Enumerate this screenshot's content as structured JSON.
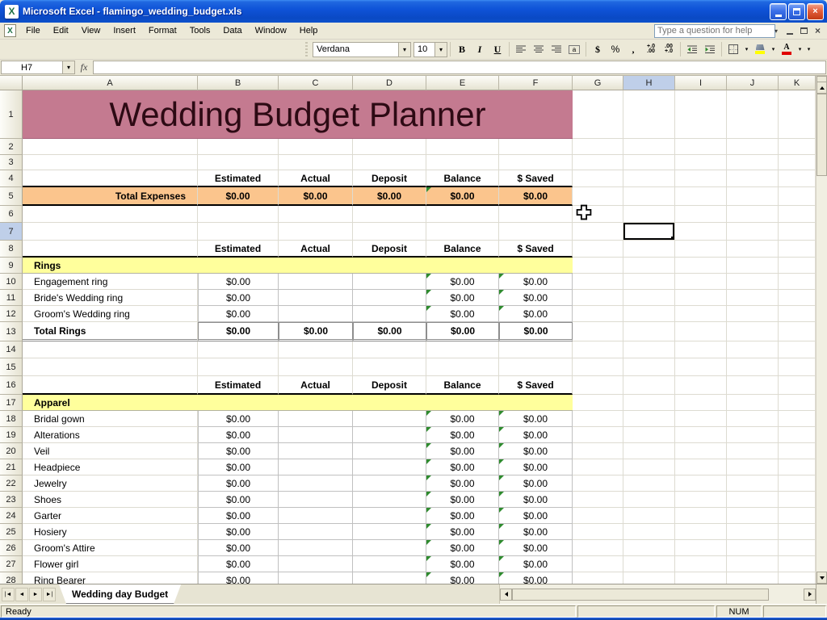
{
  "window": {
    "title": "Microsoft Excel - flamingo_wedding_budget.xls"
  },
  "menu": {
    "items": [
      "File",
      "Edit",
      "View",
      "Insert",
      "Format",
      "Tools",
      "Data",
      "Window",
      "Help"
    ],
    "help_placeholder": "Type a question for help"
  },
  "toolbar": {
    "font_name": "Verdana",
    "font_size": "10",
    "buttons": {
      "bold": "B",
      "italic": "I",
      "underline": "U",
      "currency": "$",
      "percent": "%",
      "comma": ",",
      "inc_top": "+.0",
      "inc_bottom": ".00",
      "dec_top": ".00",
      "dec_bottom": "+.0",
      "font_color_letter": "A"
    }
  },
  "formula_bar": {
    "name_box": "H7",
    "fx_label": "fx",
    "formula_value": ""
  },
  "grid": {
    "columns": [
      "A",
      "B",
      "C",
      "D",
      "E",
      "F",
      "G",
      "H",
      "I",
      "J",
      "K"
    ],
    "active_column": "H",
    "active_row": 7,
    "title": "Wedding Budget Planner",
    "value_headers": [
      "Estimated",
      "Actual",
      "Deposit",
      "Balance",
      "$ Saved"
    ],
    "zero": "$0.00",
    "total_expenses_label": "Total Expenses",
    "rows": [
      {
        "n": 1,
        "type": "banner"
      },
      {
        "n": 2,
        "type": "empty"
      },
      {
        "n": 3,
        "type": "empty"
      },
      {
        "n": 4,
        "type": "headers"
      },
      {
        "n": 5,
        "type": "total_expenses"
      },
      {
        "n": 6,
        "type": "empty"
      },
      {
        "n": 7,
        "type": "empty"
      },
      {
        "n": 8,
        "type": "headers"
      },
      {
        "n": 9,
        "type": "section",
        "label": "Rings"
      },
      {
        "n": 10,
        "type": "item",
        "label": "Engagement ring"
      },
      {
        "n": 11,
        "type": "item",
        "label": "Bride's Wedding ring"
      },
      {
        "n": 12,
        "type": "item",
        "label": "Groom's Wedding ring"
      },
      {
        "n": 13,
        "type": "total",
        "label": "Total Rings"
      },
      {
        "n": 14,
        "type": "empty"
      },
      {
        "n": 15,
        "type": "empty"
      },
      {
        "n": 16,
        "type": "headers"
      },
      {
        "n": 17,
        "type": "section",
        "label": "Apparel"
      },
      {
        "n": 18,
        "type": "item",
        "label": "Bridal gown"
      },
      {
        "n": 19,
        "type": "item",
        "label": "Alterations"
      },
      {
        "n": 20,
        "type": "item",
        "label": "Veil"
      },
      {
        "n": 21,
        "type": "item",
        "label": "Headpiece"
      },
      {
        "n": 22,
        "type": "item",
        "label": "Jewelry"
      },
      {
        "n": 23,
        "type": "item",
        "label": "Shoes"
      },
      {
        "n": 24,
        "type": "item",
        "label": "Garter"
      },
      {
        "n": 25,
        "type": "item",
        "label": "Hosiery"
      },
      {
        "n": 26,
        "type": "item",
        "label": "Groom's Attire"
      },
      {
        "n": 27,
        "type": "item",
        "label": "Flower girl"
      },
      {
        "n": 28,
        "type": "item",
        "label": "Ring Bearer"
      }
    ]
  },
  "sheet_tabs": {
    "active": "Wedding day Budget"
  },
  "status_bar": {
    "ready": "Ready",
    "num": "NUM"
  },
  "icons": {
    "dropdown": "▾",
    "close": "×",
    "tab_first": "|◄",
    "tab_prev": "◄",
    "tab_next": "►",
    "tab_last": "►|"
  },
  "colors": {
    "banner_bg": "#C47A90",
    "banner_text": "#2D0A14",
    "section_bg": "#FFFF9C",
    "total_row_bg": "#FBC58D",
    "active_header_bg": "#BFCFE9",
    "error_indicator": "#2E8B2E"
  }
}
